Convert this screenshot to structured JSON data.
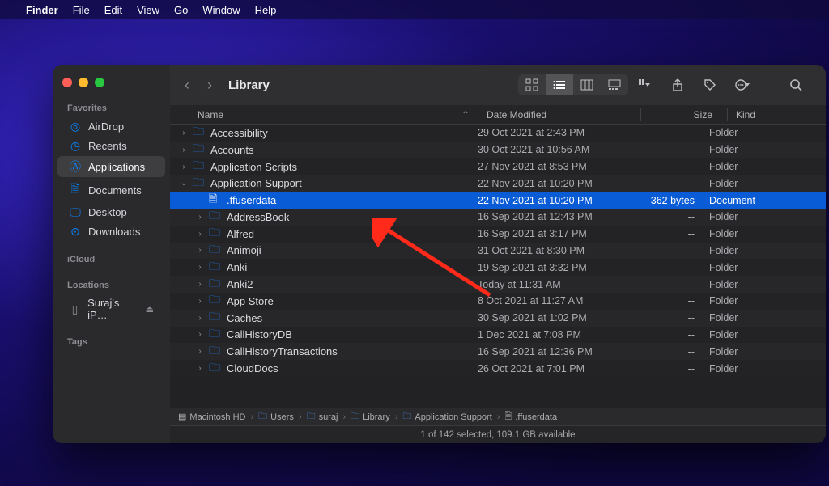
{
  "menubar": {
    "app": "Finder",
    "items": [
      "File",
      "Edit",
      "View",
      "Go",
      "Window",
      "Help"
    ]
  },
  "window": {
    "title": "Library",
    "status": "1 of 142 selected, 109.1 GB available"
  },
  "sidebar": {
    "sections": [
      {
        "label": "Favorites",
        "items": [
          {
            "icon": "airdrop",
            "label": "AirDrop"
          },
          {
            "icon": "recents",
            "label": "Recents"
          },
          {
            "icon": "apps",
            "label": "Applications",
            "selected": true
          },
          {
            "icon": "doc",
            "label": "Documents"
          },
          {
            "icon": "desktop",
            "label": "Desktop"
          },
          {
            "icon": "downloads",
            "label": "Downloads"
          }
        ]
      },
      {
        "label": "iCloud",
        "items": []
      },
      {
        "label": "Locations",
        "items": [
          {
            "icon": "device",
            "label": "Suraj's iP…",
            "eject": true
          }
        ]
      },
      {
        "label": "Tags",
        "items": []
      }
    ]
  },
  "columns": {
    "name": "Name",
    "date": "Date Modified",
    "size": "Size",
    "kind": "Kind"
  },
  "rows": [
    {
      "depth": 0,
      "disclosure": "closed",
      "type": "folder",
      "name": "Accessibility",
      "date": "29 Oct 2021 at 2:43 PM",
      "size": "--",
      "kind": "Folder"
    },
    {
      "depth": 0,
      "disclosure": "closed",
      "type": "folder",
      "name": "Accounts",
      "date": "30 Oct 2021 at 10:56 AM",
      "size": "--",
      "kind": "Folder"
    },
    {
      "depth": 0,
      "disclosure": "closed",
      "type": "folder",
      "name": "Application Scripts",
      "date": "27 Nov 2021 at 8:53 PM",
      "size": "--",
      "kind": "Folder"
    },
    {
      "depth": 0,
      "disclosure": "open",
      "type": "folder",
      "name": "Application Support",
      "date": "22 Nov 2021 at 10:20 PM",
      "size": "--",
      "kind": "Folder"
    },
    {
      "depth": 1,
      "disclosure": "none",
      "type": "doc",
      "name": ".ffuserdata",
      "date": "22 Nov 2021 at 10:20 PM",
      "size": "362 bytes",
      "kind": "Document",
      "selected": true
    },
    {
      "depth": 1,
      "disclosure": "closed",
      "type": "folder",
      "name": "AddressBook",
      "date": "16 Sep 2021 at 12:43 PM",
      "size": "--",
      "kind": "Folder"
    },
    {
      "depth": 1,
      "disclosure": "closed",
      "type": "folder",
      "name": "Alfred",
      "date": "16 Sep 2021 at 3:17 PM",
      "size": "--",
      "kind": "Folder"
    },
    {
      "depth": 1,
      "disclosure": "closed",
      "type": "folder",
      "name": "Animoji",
      "date": "31 Oct 2021 at 8:30 PM",
      "size": "--",
      "kind": "Folder"
    },
    {
      "depth": 1,
      "disclosure": "closed",
      "type": "folder",
      "name": "Anki",
      "date": "19 Sep 2021 at 3:32 PM",
      "size": "--",
      "kind": "Folder"
    },
    {
      "depth": 1,
      "disclosure": "closed",
      "type": "folder",
      "name": "Anki2",
      "date": "Today at 11:31 AM",
      "size": "--",
      "kind": "Folder"
    },
    {
      "depth": 1,
      "disclosure": "closed",
      "type": "folder",
      "name": "App Store",
      "date": "8 Oct 2021 at 11:27 AM",
      "size": "--",
      "kind": "Folder"
    },
    {
      "depth": 1,
      "disclosure": "closed",
      "type": "folder",
      "name": "Caches",
      "date": "30 Sep 2021 at 1:02 PM",
      "size": "--",
      "kind": "Folder"
    },
    {
      "depth": 1,
      "disclosure": "closed",
      "type": "folder",
      "name": "CallHistoryDB",
      "date": "1 Dec 2021 at 7:08 PM",
      "size": "--",
      "kind": "Folder"
    },
    {
      "depth": 1,
      "disclosure": "closed",
      "type": "folder",
      "name": "CallHistoryTransactions",
      "date": "16 Sep 2021 at 12:36 PM",
      "size": "--",
      "kind": "Folder"
    },
    {
      "depth": 1,
      "disclosure": "closed",
      "type": "folder",
      "name": "CloudDocs",
      "date": "26 Oct 2021 at 7:01 PM",
      "size": "--",
      "kind": "Folder"
    }
  ],
  "path": [
    {
      "icon": "disk",
      "label": "Macintosh HD"
    },
    {
      "icon": "folder",
      "label": "Users"
    },
    {
      "icon": "folder",
      "label": "suraj"
    },
    {
      "icon": "folder",
      "label": "Library"
    },
    {
      "icon": "folder",
      "label": "Application Support"
    },
    {
      "icon": "doc",
      "label": ".ffuserdata"
    }
  ]
}
